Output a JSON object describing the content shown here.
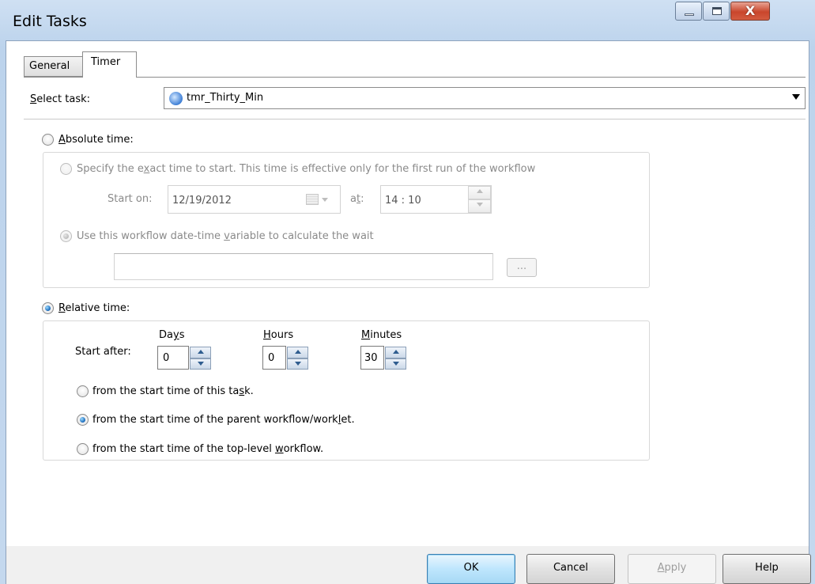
{
  "window": {
    "title": "Edit Tasks",
    "close_glyph": "X"
  },
  "tabs": [
    {
      "label": "General"
    },
    {
      "label": "Timer"
    }
  ],
  "select_task": {
    "label_accel": "S",
    "label_rest": "elect task:",
    "value": "tmr_Thirty_Min"
  },
  "absolute_time": {
    "label_accel": "A",
    "label_rest": "bsolute time:",
    "exact": {
      "label_a": "Specify the e",
      "label_accel": "x",
      "label_b": "act time to start.  This time is effective only for the first run of the workflow",
      "start_on_label": "Start on:",
      "date": "12/19/2012",
      "at_a": "a",
      "at_accel": "t",
      "at_b": ":",
      "time": "14 : 10"
    },
    "variable": {
      "label_a": "Use this workflow date-time ",
      "label_accel": "v",
      "label_b": "ariable to calculate the wait",
      "value": "",
      "browse_label": "..."
    }
  },
  "relative_time": {
    "label_accel": "R",
    "label_rest": "elative time:",
    "start_after": "Start after:",
    "days": {
      "label_a": "Da",
      "label_accel": "y",
      "label_b": "s",
      "value": "0"
    },
    "hours": {
      "label_accel": "H",
      "label_b": "ours",
      "value": "0"
    },
    "minutes": {
      "label_accel": "M",
      "label_b": "inutes",
      "value": "30"
    },
    "options": [
      {
        "a": "from the start time of this ta",
        "accel": "s",
        "b": "k."
      },
      {
        "a": "from the start time of the parent workflow/work",
        "accel": "l",
        "b": "et."
      },
      {
        "a": "from the start time of the top-level ",
        "accel": "w",
        "b": "orkflow."
      }
    ]
  },
  "buttons": {
    "ok": "OK",
    "cancel": "Cancel",
    "apply_accel": "A",
    "apply_rest": "pply",
    "help": "Help"
  }
}
